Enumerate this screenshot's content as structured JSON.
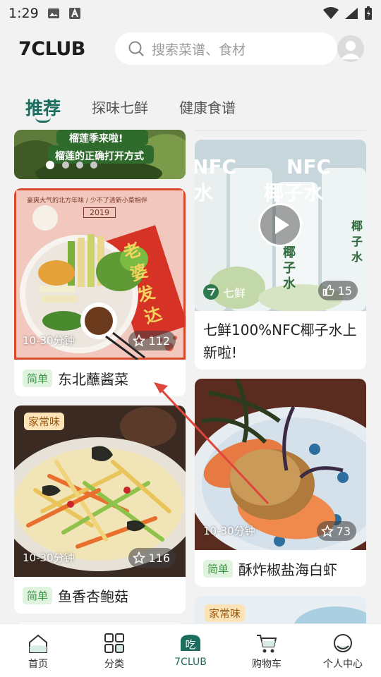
{
  "status_bar": {
    "time": "1:29"
  },
  "header": {
    "logo": "7CLUB",
    "search_placeholder": "搜索菜谱、食材"
  },
  "tabs": [
    {
      "label": "推荐",
      "active": true
    },
    {
      "label": "探味七鲜"
    },
    {
      "label": "健康食谱"
    }
  ],
  "banner": {
    "line1": "榴莲季来啦!",
    "line2": "榴莲的正确打开方式"
  },
  "cards": {
    "northeast": {
      "poster_top": "豪爽大气的北方年味 / 少不了清新小菜相伴",
      "poster_year": "2019",
      "poster_chars": "老婆发达",
      "duration": "10-30分钟",
      "likes": "112",
      "difficulty": "简单",
      "title": "东北蘸酱菜"
    },
    "coconut": {
      "poster_text_left": "NFC",
      "poster_text_left2": "水",
      "poster_text_right": "NFC",
      "poster_text_right2": "椰子水",
      "bottle_text": "椰子水",
      "brand": "七鲜",
      "likes": "15",
      "title": "七鲜100%NFC椰子水上新啦!"
    },
    "yuxiang": {
      "flavor": "家常味",
      "duration": "10-30分钟",
      "likes": "116",
      "difficulty": "简单",
      "title": "鱼香杏鲍菇"
    },
    "shrimp": {
      "duration": "10-30分钟",
      "likes": "73",
      "difficulty": "简单",
      "title": "酥炸椒盐海白虾"
    },
    "partial": {
      "flavor": "家常味"
    }
  },
  "bottom_nav": [
    {
      "label": "首页",
      "icon": "home-icon"
    },
    {
      "label": "分类",
      "icon": "category-icon"
    },
    {
      "label": "7CLUB",
      "icon": "eat-icon",
      "glyph": "吃",
      "active": true
    },
    {
      "label": "购物车",
      "icon": "cart-icon"
    },
    {
      "label": "个人中心",
      "icon": "profile-icon"
    }
  ],
  "colors": {
    "accent": "#1b6e5d",
    "easy_tag_bg": "#dff3df",
    "easy_tag_text": "#3e9a46",
    "flavor_tag_bg": "#fbe3b7",
    "arrow": "#e0453b"
  }
}
